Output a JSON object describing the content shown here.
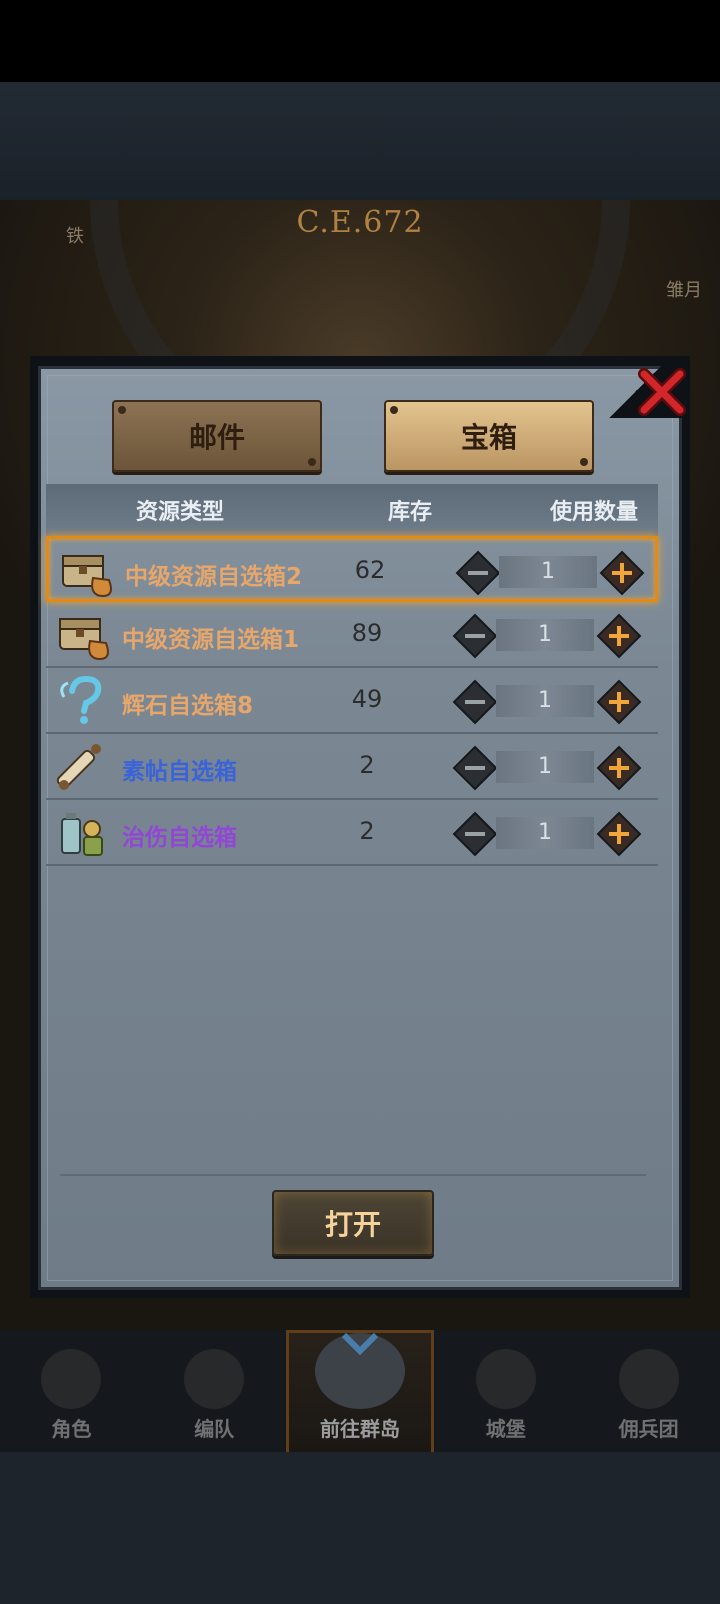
{
  "scene": {
    "era_label": "C.E.672",
    "top_left_text": "铁",
    "top_right_text": "雏月"
  },
  "tabs": [
    {
      "label": "邮件",
      "active": false
    },
    {
      "label": "宝箱",
      "active": true
    }
  ],
  "table": {
    "columns": [
      "资源类型",
      "库存",
      "使用数量"
    ],
    "rows": [
      {
        "name": "中级资源自选箱2",
        "stock": "62",
        "quantity": "1",
        "name_color": "#e7a66a",
        "icon": "treasure-chest-icon",
        "selected": true
      },
      {
        "name": "中级资源自选箱1",
        "stock": "89",
        "quantity": "1",
        "name_color": "#e7a66a",
        "icon": "treasure-chest-icon",
        "selected": false
      },
      {
        "name": "辉石自选箱8",
        "stock": "49",
        "quantity": "1",
        "name_color": "#e7a66a",
        "icon": "magic-question-icon",
        "selected": false
      },
      {
        "name": "素帖自选箱",
        "stock": "2",
        "quantity": "1",
        "name_color": "#3a63d8",
        "icon": "scroll-icon",
        "selected": false
      },
      {
        "name": "治伤自选箱",
        "stock": "2",
        "quantity": "1",
        "name_color": "#9146d6",
        "icon": "potion-bottle-icon",
        "selected": false
      }
    ]
  },
  "open_button": {
    "label": "打开"
  },
  "bottom_nav": [
    {
      "label": "角色",
      "icon": "knight-icon",
      "active": false
    },
    {
      "label": "编队",
      "icon": "formation-icon",
      "active": false
    },
    {
      "label": "前往群岛",
      "icon": "globe-icon",
      "active": true
    },
    {
      "label": "城堡",
      "icon": "castle-icon",
      "active": false
    },
    {
      "label": "佣兵团",
      "icon": "banner-icon",
      "active": false
    }
  ],
  "colors": {
    "accent_orange": "#e08a1a",
    "plus_gold": "#f2a63a",
    "panel_gray": "#7b8894"
  }
}
